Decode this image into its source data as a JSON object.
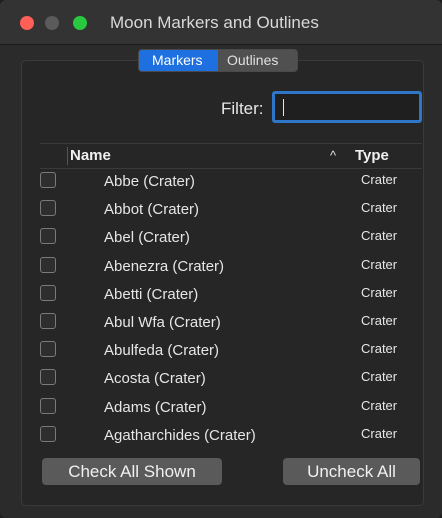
{
  "window": {
    "title": "Moon Markers and Outlines"
  },
  "tabs": [
    {
      "label": "Markers",
      "active": true
    },
    {
      "label": "Outlines",
      "active": false
    }
  ],
  "filter": {
    "label": "Filter:",
    "value": ""
  },
  "table": {
    "columns": {
      "name": "Name",
      "type": "Type",
      "sort_indicator": "^"
    },
    "rows": [
      {
        "name": "Abbe (Crater)",
        "type": "Crater",
        "checked": false
      },
      {
        "name": "Abbot (Crater)",
        "type": "Crater",
        "checked": false
      },
      {
        "name": "Abel (Crater)",
        "type": "Crater",
        "checked": false
      },
      {
        "name": "Abenezra (Crater)",
        "type": "Crater",
        "checked": false
      },
      {
        "name": "Abetti (Crater)",
        "type": "Crater",
        "checked": false
      },
      {
        "name": "Abul Wfa (Crater)",
        "type": "Crater",
        "checked": false
      },
      {
        "name": "Abulfeda (Crater)",
        "type": "Crater",
        "checked": false
      },
      {
        "name": "Acosta (Crater)",
        "type": "Crater",
        "checked": false
      },
      {
        "name": "Adams (Crater)",
        "type": "Crater",
        "checked": false
      },
      {
        "name": "Agatharchides (Crater)",
        "type": "Crater",
        "checked": false
      }
    ]
  },
  "buttons": {
    "check_all": "Check All Shown",
    "uncheck_all": "Uncheck All"
  },
  "colors": {
    "accent": "#1e6fe0",
    "close": "#ff5f57",
    "maximize": "#28c840"
  }
}
